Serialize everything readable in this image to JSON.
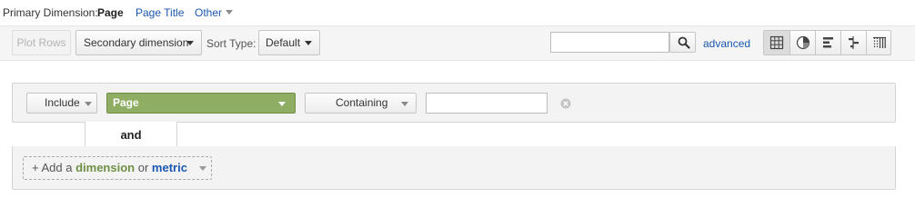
{
  "primary_dimension": {
    "label": "Primary Dimension:",
    "selected": "Page",
    "options": [
      "Page Title",
      "Other"
    ]
  },
  "toolbar": {
    "plot_rows_label": "Plot Rows",
    "secondary_dimension_label": "Secondary dimension",
    "sort_type_label": "Sort Type:",
    "sort_type_value": "Default",
    "search_value": "",
    "advanced_label": "advanced",
    "views": [
      "table-view-icon",
      "pie-view-icon",
      "performance-view-icon",
      "comparison-view-icon",
      "pivot-view-icon"
    ],
    "active_view": "table-view-icon"
  },
  "filter": {
    "include_label": "Include",
    "dimension_value": "Page",
    "match_type": "Containing",
    "value": "",
    "and_label": "and",
    "dimension_color": "#8fae63"
  },
  "add": {
    "plus_prefix": "+ Add a",
    "dimension_word": "dimension",
    "or_word": "or",
    "metric_word": "metric"
  },
  "colors": {
    "link": "#1a57b0",
    "dimension_green": "#6f9044"
  }
}
